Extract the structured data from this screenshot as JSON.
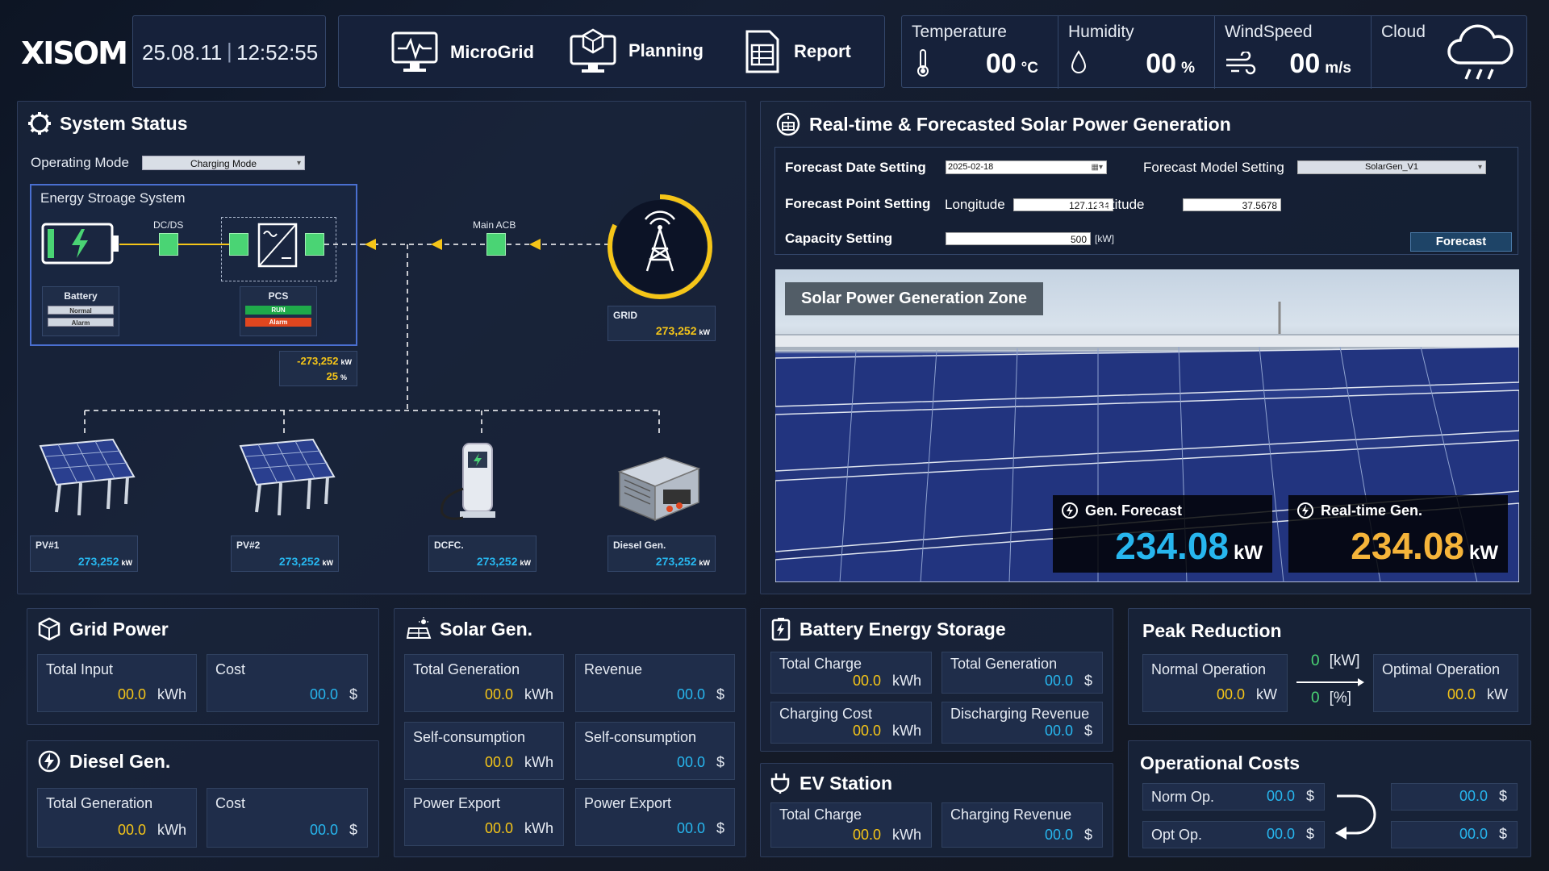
{
  "header": {
    "logo": "XISOM",
    "date": "25.08.11",
    "time": "12:52:55",
    "nav": [
      {
        "label": "MicroGrid",
        "icon": "monitor-pulse-icon"
      },
      {
        "label": "Planning",
        "icon": "monitor-cube-icon"
      },
      {
        "label": "Report",
        "icon": "report-icon"
      }
    ],
    "weather": [
      {
        "label": "Temperature",
        "value": "00",
        "unit": "°C",
        "icon": "thermometer-icon"
      },
      {
        "label": "Humidity",
        "value": "00",
        "unit": "%",
        "icon": "droplet-icon"
      },
      {
        "label": "WindSpeed",
        "value": "00",
        "unit": "m/s",
        "icon": "wind-icon"
      },
      {
        "label": "Cloud",
        "icon": "cloud-rain-icon"
      }
    ]
  },
  "system": {
    "title": "System Status",
    "mode_label": "Operating Mode",
    "mode_value": "Charging Mode",
    "ess_title": "Energy Stroage System",
    "dcds": "DC/DS",
    "main_acb": "Main ACB",
    "battery": {
      "label": "Battery",
      "b1": "Normal",
      "b2": "Alarm"
    },
    "pcs": {
      "label": "PCS",
      "b1": "RUN",
      "b2": "Alarm"
    },
    "ess_power": "-273,252",
    "ess_power_unit": "kW",
    "ess_pct": "25",
    "ess_pct_unit": "%",
    "grid": {
      "label": "GRID",
      "value": "273,252",
      "unit": "kW"
    },
    "devices": [
      {
        "label": "PV#1",
        "value": "273,252",
        "unit": "kW"
      },
      {
        "label": "PV#2",
        "value": "273,252",
        "unit": "kW"
      },
      {
        "label": "DCFC.",
        "value": "273,252",
        "unit": "kW"
      },
      {
        "label": "Diesel Gen.",
        "value": "273,252",
        "unit": "kW"
      }
    ]
  },
  "solar": {
    "title": "Real-time & Forecasted Solar Power Generation",
    "date_label": "Forecast Date Setting",
    "date_value": "2025-02-18",
    "model_label": "Forecast Model Setting",
    "model_value": "SolarGen_V1",
    "point_label": "Forecast Point Setting",
    "lon_label": "Longitude",
    "lon_value": "127.1234",
    "lat_label": "Latitude",
    "lat_value": "37.5678",
    "cap_label": "Capacity Setting",
    "cap_value": "500",
    "cap_unit": "[kW]",
    "forecast_btn": "Forecast",
    "zone": "Solar Power Generation Zone",
    "gen_forecast_label": "Gen. Forecast",
    "gen_forecast_value": "234.08",
    "gen_forecast_unit": "kW",
    "realtime_label": "Real-time Gen.",
    "realtime_value": "234.08",
    "realtime_unit": "kW"
  },
  "grid_power": {
    "title": "Grid Power",
    "items": [
      {
        "label": "Total Input",
        "value": "00.0",
        "unit": "kWh"
      },
      {
        "label": "Cost",
        "value": "00.0",
        "unit": "$"
      }
    ]
  },
  "diesel": {
    "title": "Diesel Gen.",
    "items": [
      {
        "label": "Total Generation",
        "value": "00.0",
        "unit": "kWh"
      },
      {
        "label": "Cost",
        "value": "00.0",
        "unit": "$"
      }
    ]
  },
  "solar_gen": {
    "title": "Solar Gen.",
    "items": [
      {
        "label": "Total Generation",
        "value": "00.0",
        "unit": "kWh"
      },
      {
        "label": "Revenue",
        "value": "00.0",
        "unit": "$"
      },
      {
        "label": "Self-consumption",
        "value": "00.0",
        "unit": "kWh"
      },
      {
        "label": "Self-consumption",
        "value": "00.0",
        "unit": "$"
      },
      {
        "label": "Power Export",
        "value": "00.0",
        "unit": "kWh"
      },
      {
        "label": "Power Export",
        "value": "00.0",
        "unit": "$"
      }
    ]
  },
  "bess": {
    "title": "Battery Energy Storage",
    "items": [
      {
        "label": "Total Charge",
        "value": "00.0",
        "unit": "kWh"
      },
      {
        "label": "Total Generation",
        "value": "00.0",
        "unit": "$"
      },
      {
        "label": "Charging Cost",
        "value": "00.0",
        "unit": "kWh"
      },
      {
        "label": "Discharging Revenue",
        "value": "00.0",
        "unit": "$"
      }
    ]
  },
  "ev": {
    "title": "EV Station",
    "items": [
      {
        "label": "Total Charge",
        "value": "00.0",
        "unit": "kWh"
      },
      {
        "label": "Charging Revenue",
        "value": "00.0",
        "unit": "$"
      }
    ]
  },
  "peak": {
    "title": "Peak Reduction",
    "normal_label": "Normal Operation",
    "normal_value": "00.0",
    "normal_unit": "kW",
    "optimal_label": "Optimal Operation",
    "optimal_value": "00.0",
    "optimal_unit": "kW",
    "delta_kw": "0",
    "delta_kw_unit": "[kW]",
    "delta_pct": "0",
    "delta_pct_unit": "[%]"
  },
  "opcost": {
    "title": "Operational Costs",
    "norm_label": "Norm Op.",
    "norm_value": "00.0",
    "opt_label": "Opt Op.",
    "opt_value": "00.0",
    "right1": "00.0",
    "right2": "00.0",
    "unit": "$"
  },
  "colors": {
    "accent_blue": "#27b6ee",
    "accent_yellow": "#f5c518",
    "panel": "#18233a"
  }
}
